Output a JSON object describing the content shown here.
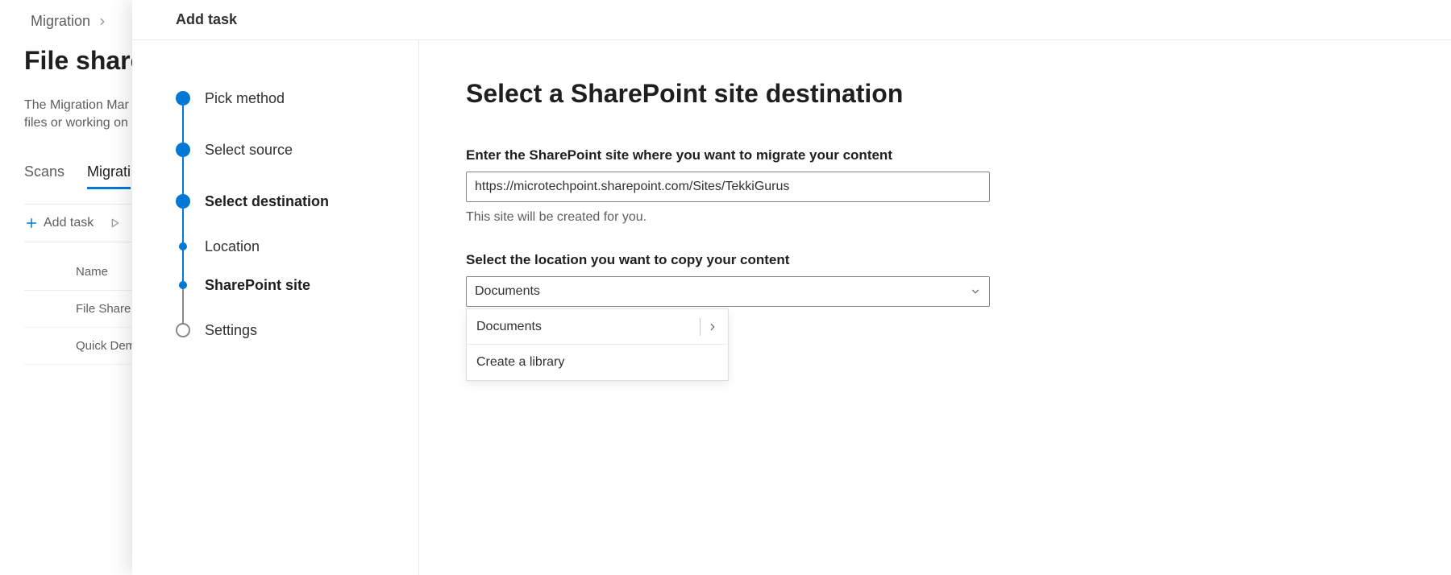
{
  "breadcrumb": {
    "label": "Migration"
  },
  "page": {
    "title": "File share",
    "subtitle_line1": "The Migration Mar",
    "subtitle_line2": "files or working on"
  },
  "tabs": {
    "scans": "Scans",
    "migrations": "Migrati"
  },
  "toolbar": {
    "add_task": "Add task"
  },
  "table": {
    "header_name": "Name",
    "rows": [
      "File Share",
      "Quick Dem"
    ]
  },
  "panel": {
    "title": "Add task",
    "steps": {
      "pick_method": "Pick method",
      "select_source": "Select source",
      "select_destination": "Select destination",
      "location": "Location",
      "sharepoint_site": "SharePoint site",
      "settings": "Settings"
    },
    "form": {
      "heading": "Select a SharePoint site destination",
      "site_label": "Enter the SharePoint site where you want to migrate your content",
      "site_value": "https://microtechpoint.sharepoint.com/Sites/TekkiGurus",
      "site_help": "This site will be created for you.",
      "location_label": "Select the location you want to copy your content",
      "location_value": "Documents",
      "options": {
        "documents": "Documents",
        "create_library": "Create a library"
      }
    }
  }
}
